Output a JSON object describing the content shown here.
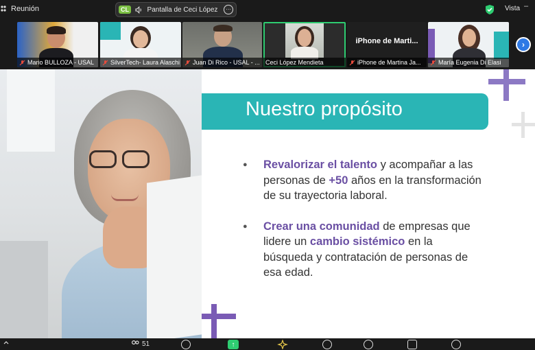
{
  "window": {
    "title": "Reunión",
    "view_label": "Vista"
  },
  "share_banner": {
    "badge": "CL",
    "text": "Pantalla de Ceci López Mendieta"
  },
  "participants": [
    {
      "name": "Mario BULLOZA - USAL"
    },
    {
      "name": "SilverTech- Laura Alaschi"
    },
    {
      "name": "Juan Di Rico - USAL - ..."
    },
    {
      "name": "Ceci López Mendieta",
      "active": true
    },
    {
      "name": "iPhone de Martina Ja...",
      "center_label": "iPhone de Marti..."
    },
    {
      "name": "María Eugenia Di Elasi"
    }
  ],
  "slide": {
    "title": "Nuestro propósito",
    "bullets": [
      {
        "parts": [
          {
            "text": "Revalorizar el talento",
            "em": true
          },
          {
            "text": " y acompañar a las personas de ",
            "em": false
          },
          {
            "text": "+50",
            "em": true
          },
          {
            "text": " años en la transformación de su trayectoria laboral.",
            "em": false
          }
        ]
      },
      {
        "parts": [
          {
            "text": "Crear una comunidad",
            "em": true
          },
          {
            "text": " de empresas que lidere un ",
            "em": false
          },
          {
            "text": "cambio sistémico",
            "em": true
          },
          {
            "text": " en la búsqueda y contratación de personas de esa edad.",
            "em": false
          }
        ]
      }
    ]
  },
  "toolbar": {
    "participants_count": "51"
  },
  "colors": {
    "accent_teal": "#2ab5b5",
    "accent_purple": "#6a4fa3",
    "active_green": "#2ecc71",
    "zoom_blue": "#2f7ae5"
  }
}
